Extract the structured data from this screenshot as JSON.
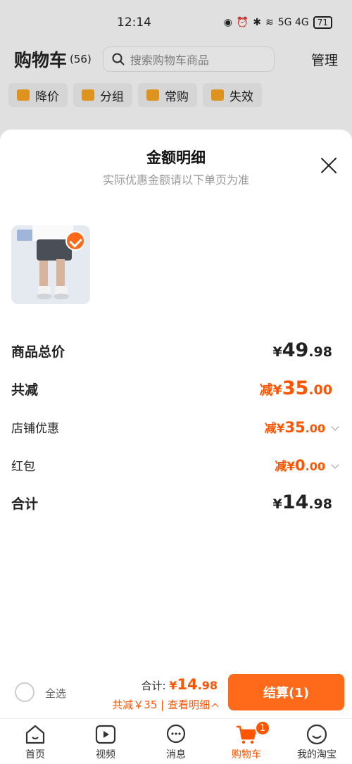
{
  "status_bar": {
    "time": "12:14",
    "battery": "71",
    "network": "5G 4G"
  },
  "cart_header": {
    "title": "购物车",
    "count": "(56)",
    "search_placeholder": "搜索购物车商品",
    "manage_label": "管理"
  },
  "filters": [
    {
      "label": "降价",
      "icon": "price-drop-icon"
    },
    {
      "label": "分组",
      "icon": "folder-icon"
    },
    {
      "label": "常购",
      "icon": "cart-icon"
    },
    {
      "label": "失效",
      "icon": "invalid-icon"
    }
  ],
  "sheet": {
    "title": "金额明细",
    "subtitle": "实际优惠金额请以下单页为准",
    "close_icon": "close-icon",
    "product_selected": true,
    "rows": {
      "total_price": {
        "label": "商品总价",
        "currency": "¥",
        "int": "49",
        "dec": ".98"
      },
      "total_discount": {
        "label": "共减",
        "prefix": "减",
        "currency": "¥",
        "int": "35",
        "dec": ".00"
      },
      "store_discount": {
        "label": "店铺优惠",
        "prefix": "减",
        "currency": "¥",
        "int": "35",
        "dec": ".00"
      },
      "red_packet": {
        "label": "红包",
        "prefix": "减",
        "currency": "¥",
        "int": "0",
        "dec": ".00"
      },
      "grand_total": {
        "label": "合计",
        "currency": "¥",
        "int": "14",
        "dec": ".98"
      }
    }
  },
  "checkout": {
    "select_all_label": "全选",
    "total_label": "合计:",
    "total_currency": "¥",
    "total_int": "14",
    "total_dec": ".98",
    "discount_text": "共减￥35",
    "details_link": "查看明细",
    "settle_button": "结算(1)"
  },
  "tabbar": [
    {
      "label": "首页",
      "icon": "home-icon"
    },
    {
      "label": "视频",
      "icon": "video-icon"
    },
    {
      "label": "消息",
      "icon": "message-icon"
    },
    {
      "label": "购物车",
      "icon": "cart-icon",
      "active": true,
      "badge": "1"
    },
    {
      "label": "我的淘宝",
      "icon": "profile-icon"
    }
  ],
  "colors": {
    "accent": "#ff5500",
    "button": "#ff6a1a"
  }
}
